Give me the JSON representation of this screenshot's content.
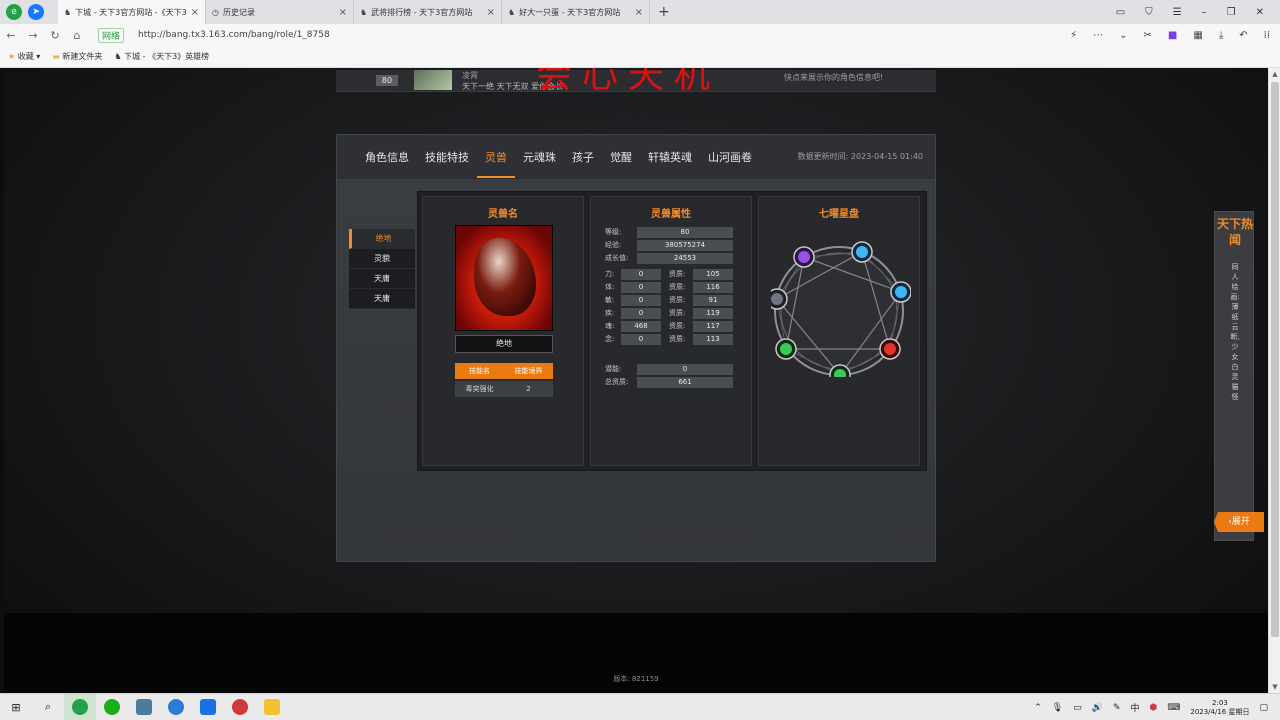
{
  "browser": {
    "tabs": [
      {
        "title": "下城 - 天下3官方网站 -《天下3》",
        "active": true
      },
      {
        "title": "历史记录",
        "active": false
      },
      {
        "title": "武将排行榜 - 天下3官方网站",
        "active": false
      },
      {
        "title": "好大一只蛋 - 天下3官方网站",
        "active": false
      }
    ],
    "new_tab": "+",
    "security_badge": "网络",
    "url": "http://bang.tx3.163.com/bang/role/1_8758",
    "bookmarks": [
      "收藏",
      "新建文件夹",
      "下城 - 《天下3》英雄榜"
    ]
  },
  "page": {
    "watermark": "会心天机",
    "top_card": {
      "level": "80",
      "name": "凌霄",
      "motto": "天下一绝 天下无双 爱你会长",
      "promo": "快点来展示你的角色信息吧!"
    },
    "nav": {
      "tabs": [
        "角色信息",
        "技能特技",
        "灵兽",
        "元魂珠",
        "孩子",
        "觉醒",
        "轩辕英魂",
        "山河画卷"
      ],
      "active_index": 2,
      "update_time": "数据更新时间: 2023-04-15 01:40"
    },
    "side_list": [
      "绝地",
      "灵貌",
      "天庸",
      "天庸"
    ],
    "pet_column": {
      "title": "灵兽名",
      "pet_name": "绝地",
      "skill_headers": [
        "技能名",
        "技能境界"
      ],
      "skills": [
        {
          "name": "毒突强化",
          "level": "2"
        }
      ]
    },
    "attr_column": {
      "title": "灵兽属性",
      "level_label": "等级:",
      "level": "80",
      "exp_label": "经验:",
      "exp": "380575274",
      "growth_label": "成长值:",
      "growth": "24553",
      "stats": [
        {
          "label": "力:",
          "value": "0",
          "apt_label": "资质:",
          "apt": "105"
        },
        {
          "label": "体:",
          "value": "0",
          "apt_label": "资质:",
          "apt": "116"
        },
        {
          "label": "敏:",
          "value": "0",
          "apt_label": "资质:",
          "apt": "91"
        },
        {
          "label": "疾:",
          "value": "0",
          "apt_label": "资质:",
          "apt": "119"
        },
        {
          "label": "魂:",
          "value": "468",
          "apt_label": "资质:",
          "apt": "117"
        },
        {
          "label": "念:",
          "value": "0",
          "apt_label": "资质:",
          "apt": "113"
        }
      ],
      "potential_label": "潜能:",
      "potential": "0",
      "total_apt_label": "总资质:",
      "total_apt": "661"
    },
    "star_column": {
      "title": "七曜星盘"
    },
    "side_float": {
      "title": "天下热闻",
      "text": "同人绘画:薄纸云断,少女白灵猫怪",
      "expand": "展开"
    },
    "footer": "版本: 821159"
  },
  "taskbar": {
    "time": "2:03",
    "date": "2023/4/16 星期日",
    "ime": "中"
  },
  "colors": {
    "accent": "#f08a2a",
    "watermark": "#e01010"
  }
}
